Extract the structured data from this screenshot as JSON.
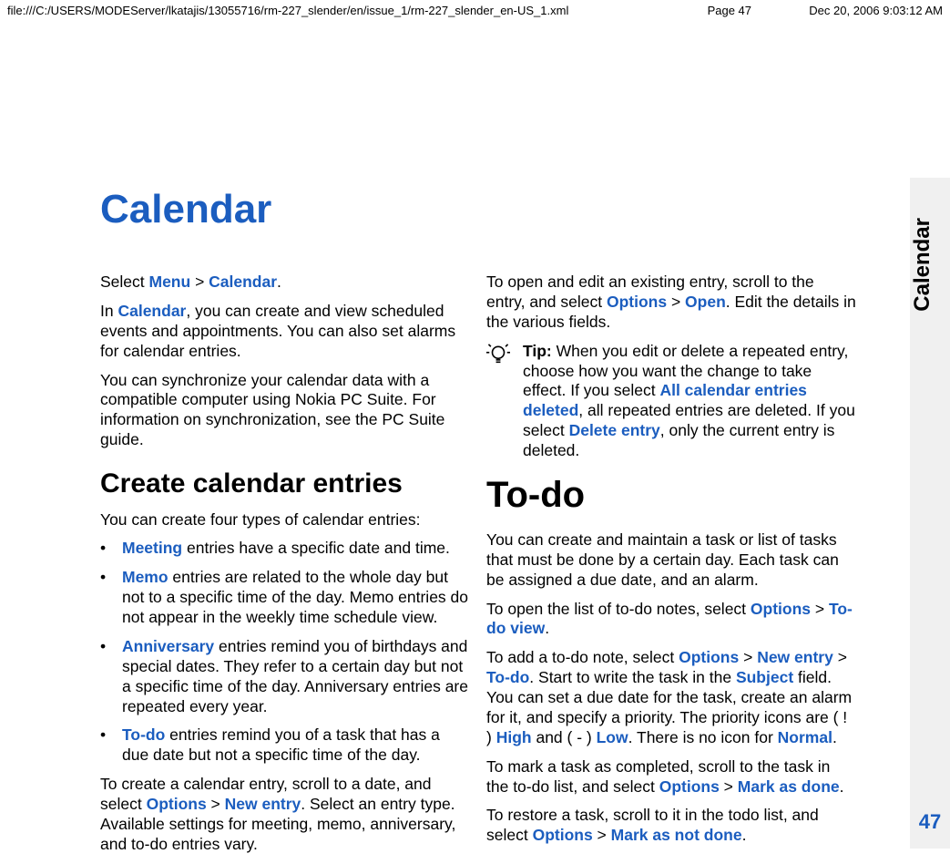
{
  "header": {
    "path": "file:///C:/USERS/MODEServer/lkatajis/13055716/rm-227_slender/en/issue_1/rm-227_slender_en-US_1.xml",
    "page": "Page 47",
    "date": "Dec 20, 2006 9:03:12 AM"
  },
  "sidetab": {
    "label": "Calendar",
    "pagenum": "47"
  },
  "title": "Calendar",
  "left": {
    "p1a": "Select ",
    "p1_menu": "Menu",
    "p1_gt": " > ",
    "p1_cal": "Calendar",
    "p1b": ".",
    "p2a": "In ",
    "p2_cal": "Calendar",
    "p2b": ", you can create and view scheduled events and appointments. You can also set alarms for calendar entries.",
    "p3": "You can synchronize your calendar data with a compatible computer using Nokia PC Suite. For information on synchronization, see the PC Suite guide.",
    "h2": "Create calendar entries",
    "p4": "You can create four types of calendar entries:",
    "bullets": [
      {
        "term": "Meeting",
        "text": " entries have a specific date and time."
      },
      {
        "term": "Memo",
        "text": " entries are related to the whole day but not to a specific time of the day. Memo entries do not appear in the weekly time schedule view."
      },
      {
        "term": "Anniversary",
        "text": " entries remind you of birthdays and special dates. They refer to a certain day but not a specific time of the day. Anniversary entries are repeated every year."
      },
      {
        "term": "To-do",
        "text": " entries remind you of a task that has a due date but not a specific time of the day."
      }
    ],
    "p5a": "To create a calendar entry, scroll to a date, and select ",
    "p5_opt": "Options",
    "p5_gt": " > ",
    "p5_new": "New entry",
    "p5b": ". Select an entry type. Available settings for meeting, memo, anniversary, and to-do entries vary."
  },
  "right": {
    "p1a": "To open and edit an existing entry, scroll to the entry, and select ",
    "p1_opt": "Options",
    "p1_gt": " > ",
    "p1_open": "Open",
    "p1b": ". Edit the details in the various fields.",
    "tip_label": "Tip:  ",
    "tip_a": "When you edit or delete a repeated entry, choose how you want the change to take effect. If you select ",
    "tip_all": "All calendar entries deleted",
    "tip_b": ", all repeated entries are deleted. If you select ",
    "tip_del": "Delete entry",
    "tip_c": ", only the current entry is deleted.",
    "h2": "To-do",
    "p2": "You can create and maintain a task or list of tasks that must be done by a certain day. Each task can be assigned a due date, and an alarm.",
    "p3a": "To open the list of to-do notes, select ",
    "p3_opt": "Options",
    "p3_gt": " > ",
    "p3_view": "To-do view",
    "p3b": ".",
    "p4a": "To add a to-do note, select ",
    "p4_opt": "Options",
    "p4_gt1": " > ",
    "p4_new": "New entry",
    "p4_gt2": " > ",
    "p4_todo": "To-do",
    "p4b": ". Start to write the task in the ",
    "p4_subj": "Subject",
    "p4c": " field. You can set a due date for the task, create an alarm for it, and specify a priority. The priority icons are ( ! ) ",
    "p4_high": "High",
    "p4d": " and ( - ) ",
    "p4_low": "Low",
    "p4e": ". There is no icon for ",
    "p4_norm": "Normal",
    "p4f": ".",
    "p5a": "To mark a task as completed, scroll to the task in the to-do list, and select ",
    "p5_opt": "Options",
    "p5_gt": " > ",
    "p5_mark": "Mark as done",
    "p5b": ".",
    "p6a": "To restore a task, scroll to it in the todo list, and select ",
    "p6_opt": "Options",
    "p6_gt": " > ",
    "p6_mark": "Mark as not done",
    "p6b": "."
  }
}
